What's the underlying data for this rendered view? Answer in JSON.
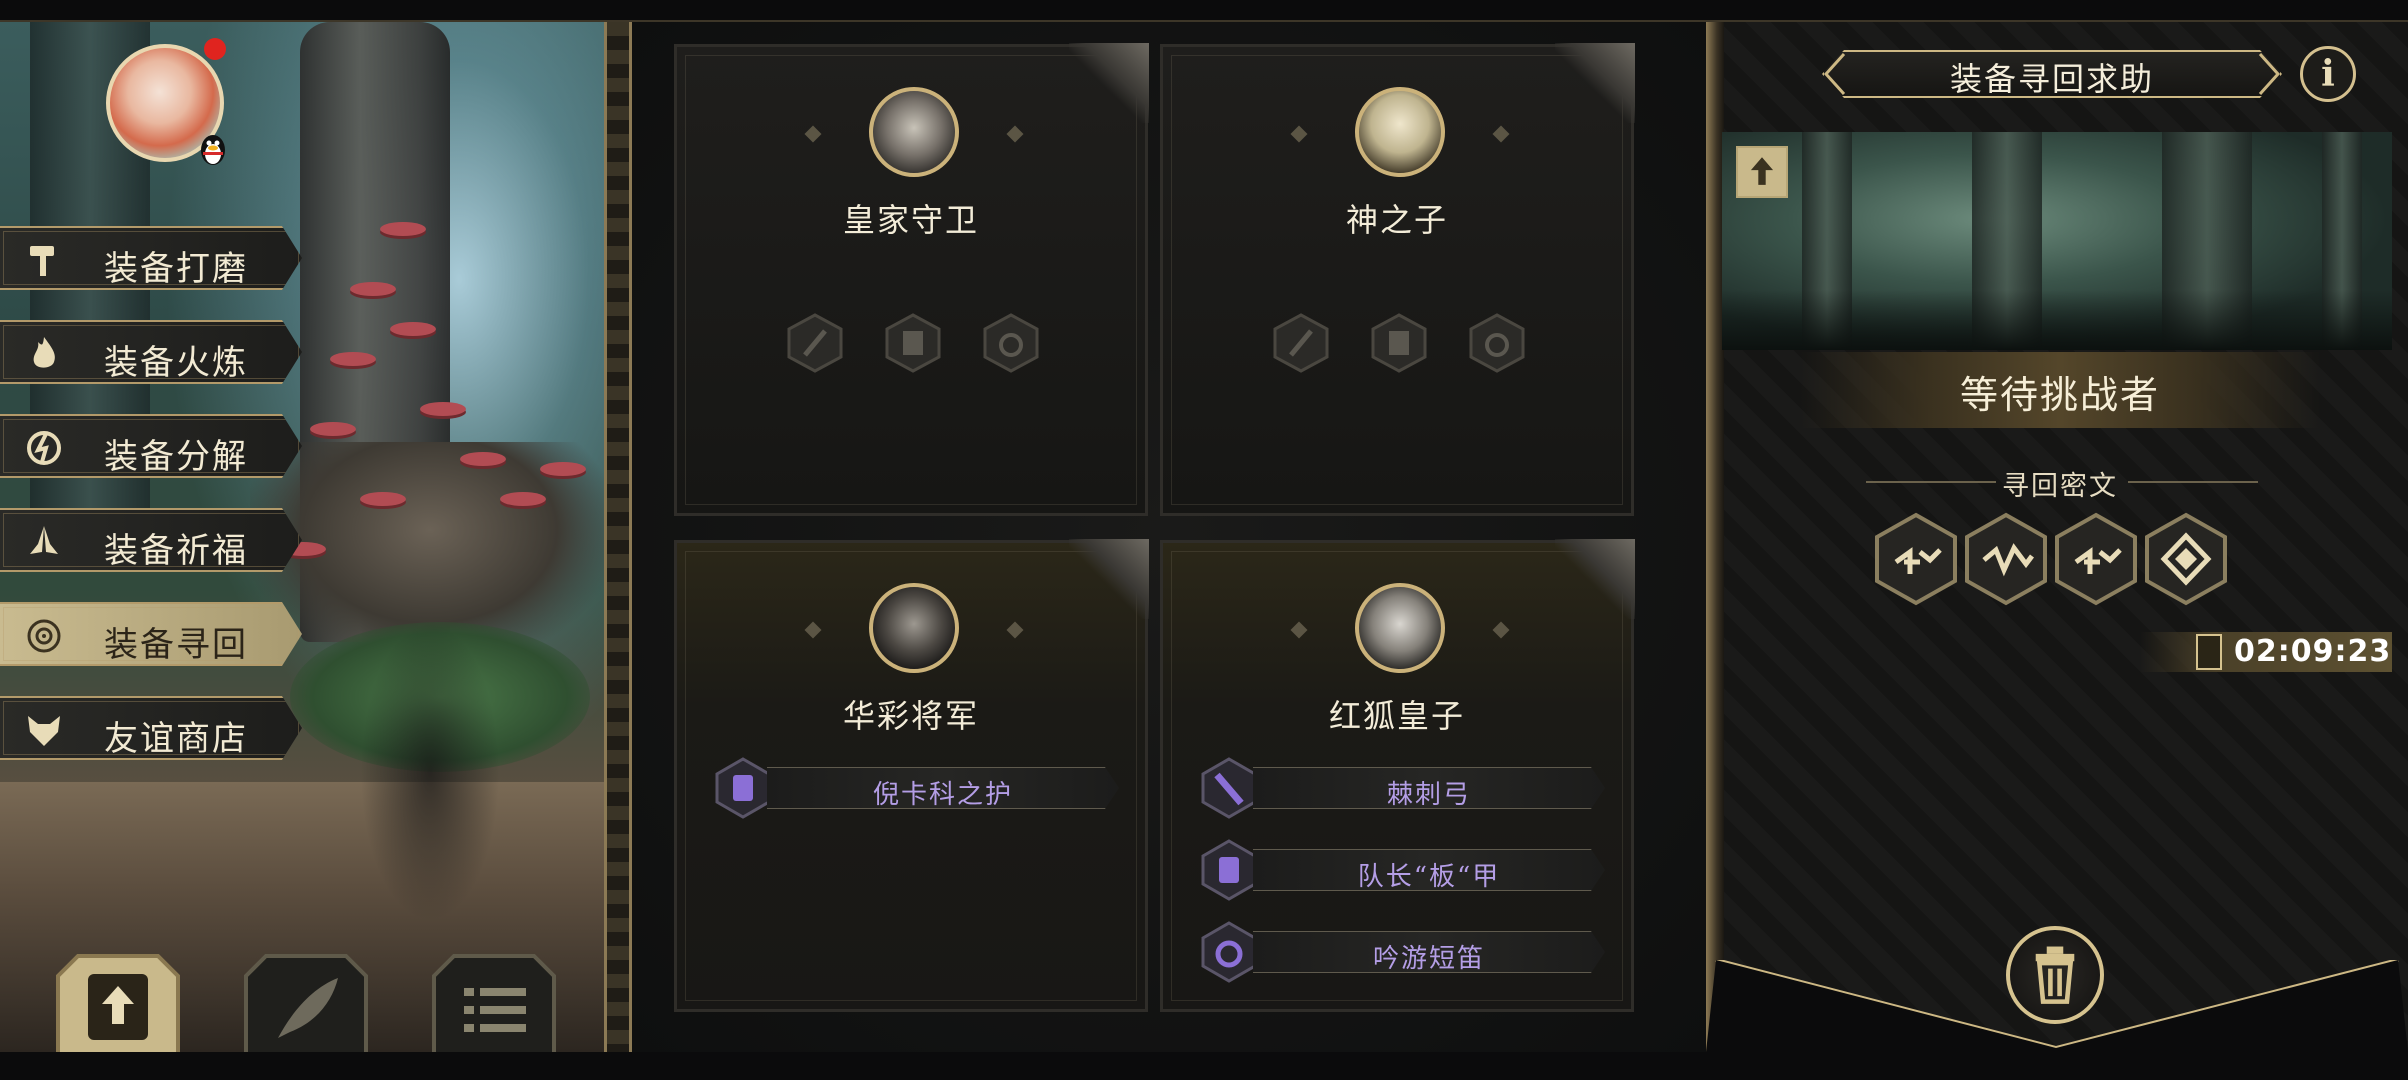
{
  "menu": {
    "items": [
      {
        "label": "装备打磨",
        "icon": "hammer-icon",
        "active": false
      },
      {
        "label": "装备火炼",
        "icon": "flame-icon",
        "active": false
      },
      {
        "label": "装备分解",
        "icon": "disassemble-icon",
        "active": false
      },
      {
        "label": "装备祈福",
        "icon": "pray-hands-icon",
        "active": false
      },
      {
        "label": "装备寻回",
        "icon": "target-icon",
        "active": true
      },
      {
        "label": "友谊商店",
        "icon": "fox-icon",
        "active": false
      }
    ]
  },
  "bottom_buttons": [
    "upload-icon",
    "feather-icon",
    "list-icon"
  ],
  "cards": [
    {
      "name": "皇家守卫",
      "equipment": []
    },
    {
      "name": "神之子",
      "equipment": []
    },
    {
      "name": "华彩将军",
      "equipment": [
        {
          "label": "倪卡科之护",
          "icon": "armor-icon"
        }
      ]
    },
    {
      "name": "红狐皇子",
      "equipment": [
        {
          "label": "棘刺弓",
          "icon": "sword-icon"
        },
        {
          "label": "队长“板“甲",
          "icon": "armor-icon"
        },
        {
          "label": "吟游短笛",
          "icon": "ring-icon"
        }
      ]
    }
  ],
  "right_panel": {
    "title": "装备寻回求助",
    "info_label": "i",
    "status": "等待挑战者",
    "runes_title": "寻回密文",
    "runes": [
      "rune-1-icon",
      "rune-2-icon",
      "rune-3-icon",
      "rune-4-icon"
    ],
    "timer": "02:09:23"
  },
  "colors": {
    "gold": "#cdb884",
    "equipment_text": "#b49ee6",
    "active_menu": "#c9bb90"
  }
}
